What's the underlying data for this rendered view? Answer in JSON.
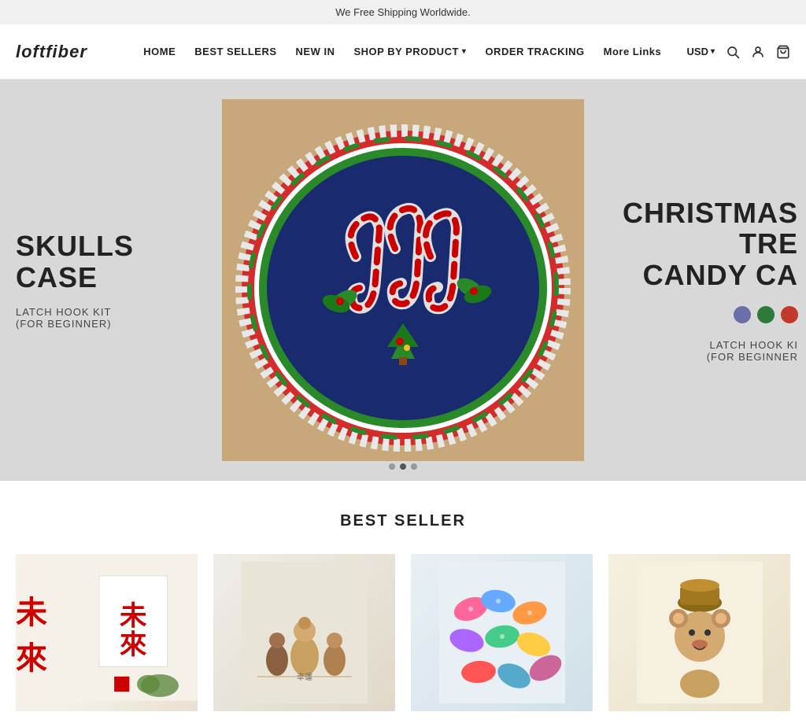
{
  "banner": {
    "text": "We Free Shipping Worldwide."
  },
  "header": {
    "logo": "loftfiber",
    "nav": [
      {
        "label": "HOME",
        "hasDropdown": false
      },
      {
        "label": "BEST SELLERS",
        "hasDropdown": false
      },
      {
        "label": "NEW IN",
        "hasDropdown": false
      },
      {
        "label": "SHOP BY PRODUCT",
        "hasDropdown": true
      },
      {
        "label": "ORDER TRACKING",
        "hasDropdown": false
      },
      {
        "label": "More Links",
        "hasDropdown": false
      }
    ],
    "currency": "USD",
    "icons": {
      "search": "🔍",
      "account": "👤",
      "cart": "🛒"
    }
  },
  "hero": {
    "left": {
      "productName": "SKULLS\nCASE",
      "sub": "LATCH HOOK KIT\n(FOR BEGINNER)"
    },
    "right": {
      "productName": "CHRISTMAS TRE\nCANDY CA",
      "sub": "LATCH HOOK KI\n(FOR BEGINNER",
      "colorDots": [
        {
          "color": "#6b6fa8"
        },
        {
          "color": "#2d7a3a"
        },
        {
          "color": "#c0392b"
        }
      ]
    },
    "sliderDots": [
      {
        "active": false
      },
      {
        "active": true
      },
      {
        "active": false
      }
    ]
  },
  "bestSeller": {
    "title": "BEST SELLER",
    "products": [
      {
        "id": 1,
        "imgType": "calligraphy",
        "emoji": "🖊️"
      },
      {
        "id": 2,
        "imgType": "figurines",
        "emoji": "🪆"
      },
      {
        "id": 3,
        "imgType": "slippers",
        "emoji": "🧤"
      },
      {
        "id": 4,
        "imgType": "bear",
        "emoji": "🐻"
      }
    ]
  }
}
